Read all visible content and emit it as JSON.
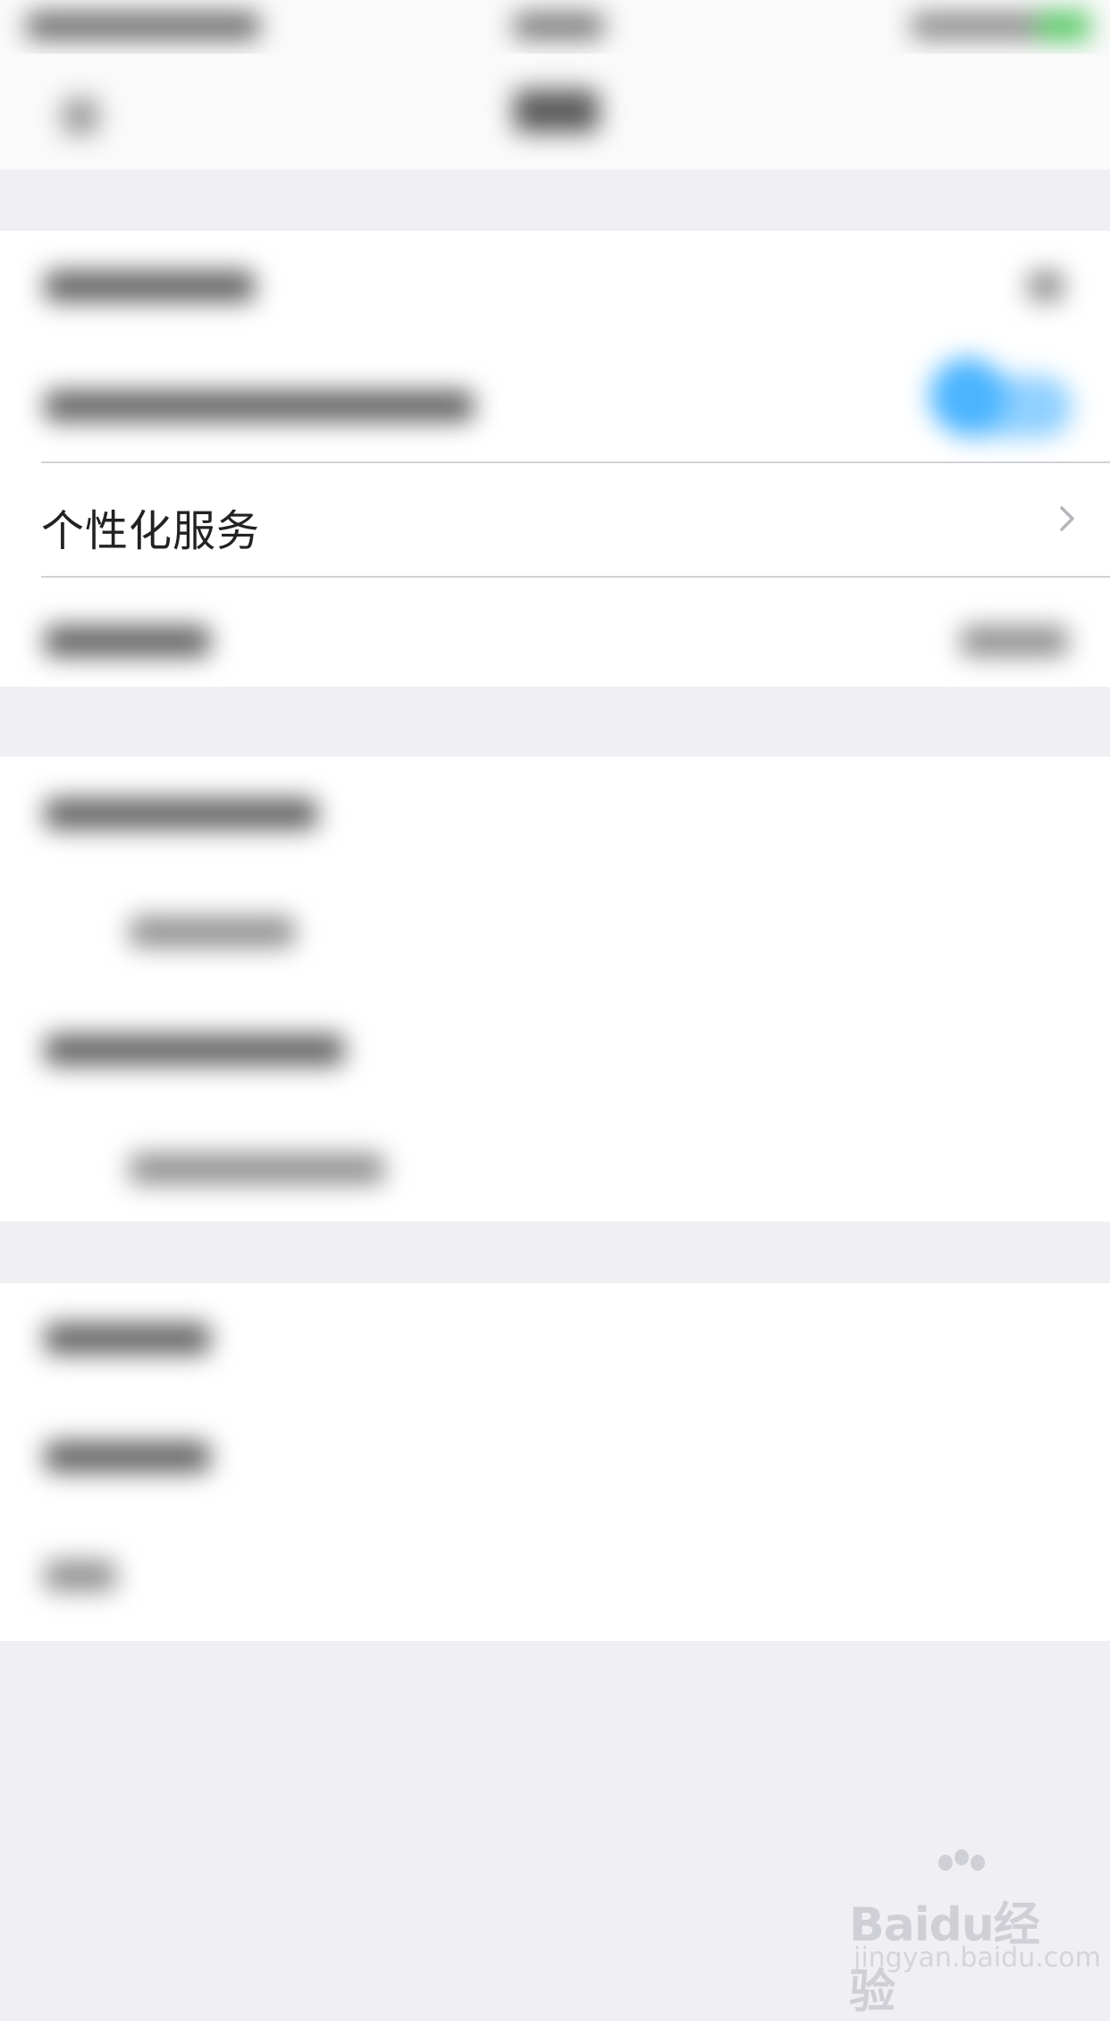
{
  "settings": {
    "personalized_service_label": "个性化服务"
  },
  "watermark": {
    "logo": "Baidu经验",
    "url": "jingyan.baidu.com"
  },
  "colors": {
    "background": "#efeff4",
    "toggle_on": "#4ab4ff",
    "separator": "#d2d2d6"
  }
}
